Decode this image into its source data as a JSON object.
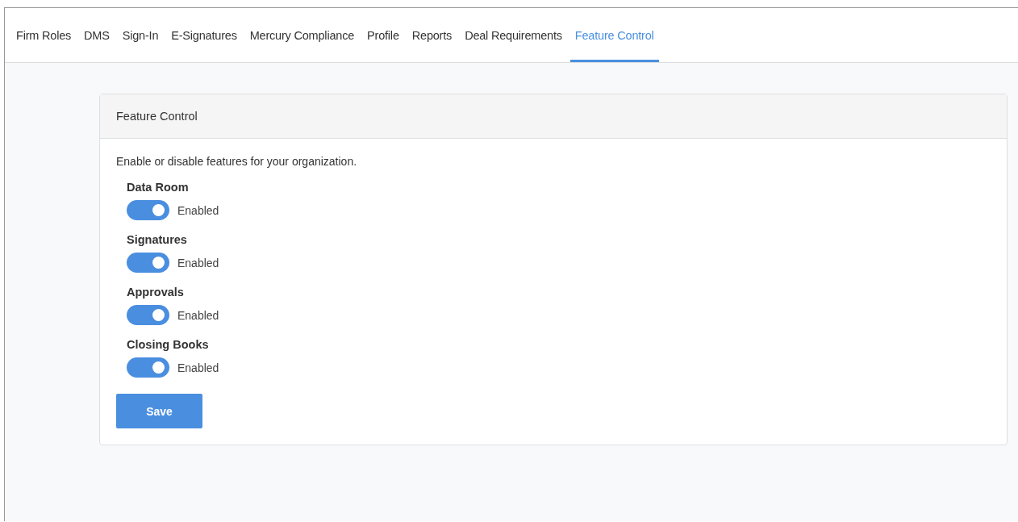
{
  "tabs": [
    {
      "label": "Firm Roles",
      "selected": false
    },
    {
      "label": "DMS",
      "selected": false
    },
    {
      "label": "Sign-In",
      "selected": false
    },
    {
      "label": "E-Signatures",
      "selected": false
    },
    {
      "label": "Mercury Compliance",
      "selected": false
    },
    {
      "label": "Profile",
      "selected": false
    },
    {
      "label": "Reports",
      "selected": false
    },
    {
      "label": "Deal Requirements",
      "selected": false
    },
    {
      "label": "Feature Control",
      "selected": true
    }
  ],
  "card": {
    "title": "Feature Control",
    "description": "Enable or disable features for your organization.",
    "features": [
      {
        "name": "Data Room",
        "on": true,
        "status": "Enabled"
      },
      {
        "name": "Signatures",
        "on": true,
        "status": "Enabled"
      },
      {
        "name": "Approvals",
        "on": true,
        "status": "Enabled"
      },
      {
        "name": "Closing Books",
        "on": true,
        "status": "Enabled"
      }
    ],
    "button": "Save"
  }
}
